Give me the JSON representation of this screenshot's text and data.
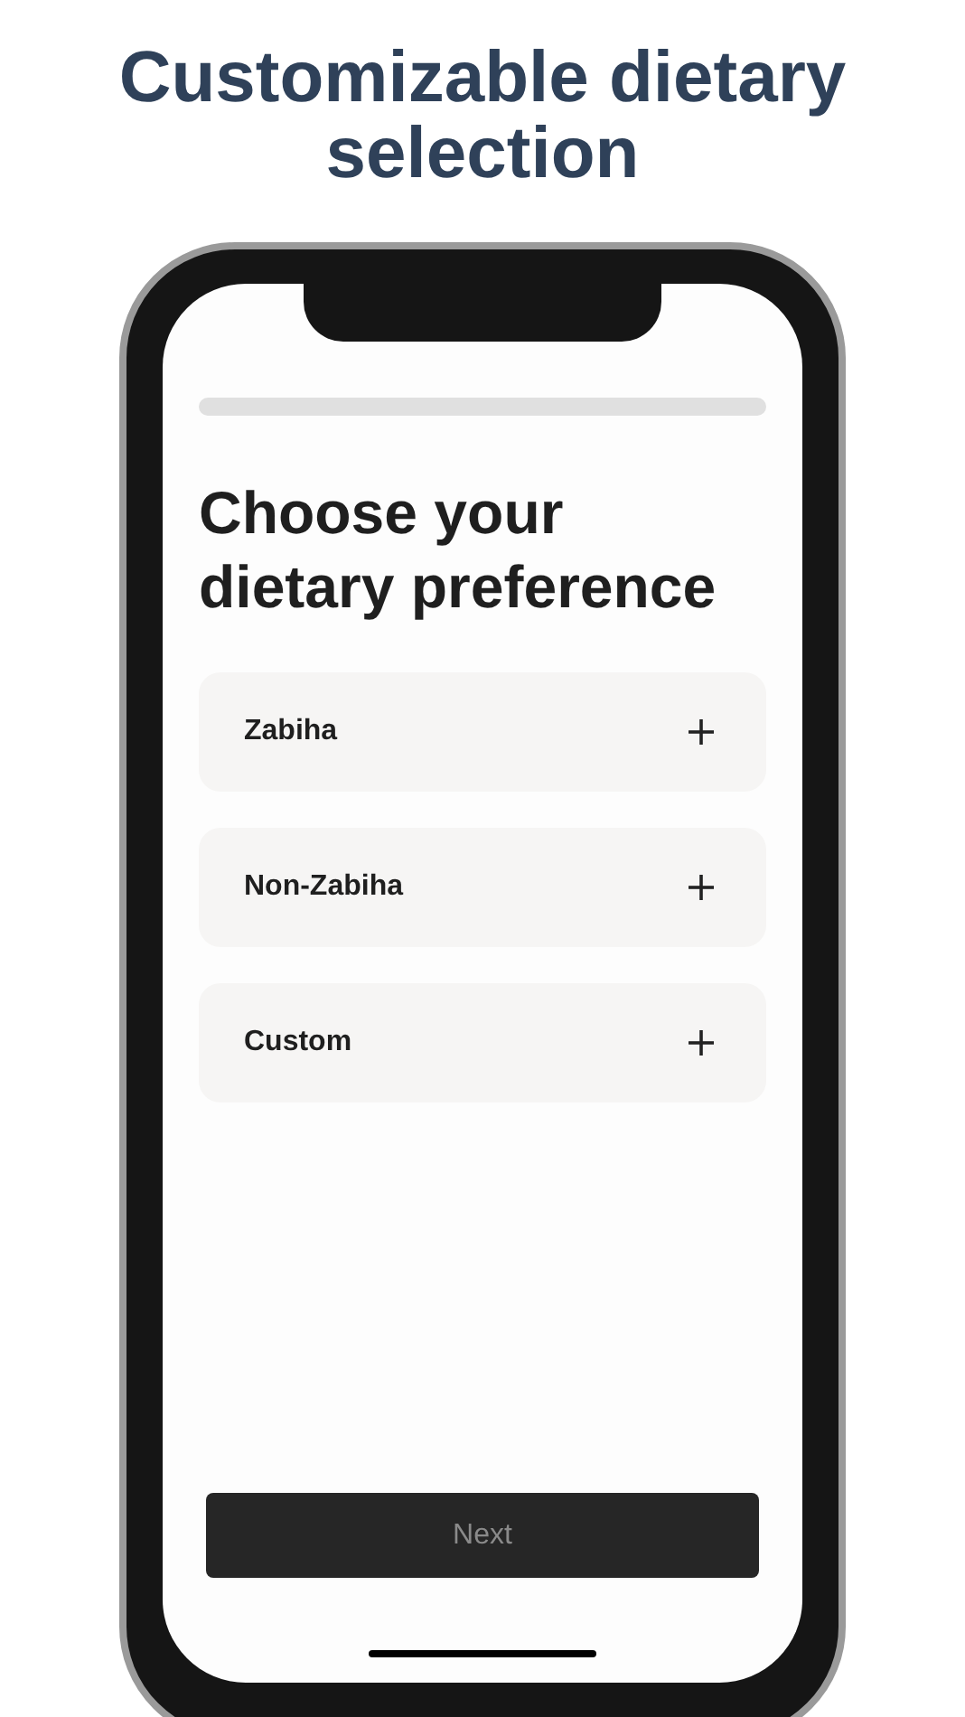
{
  "headline": "Customizable dietary selection",
  "progress": {
    "level": 0
  },
  "title": "Choose your dietary preference",
  "options": [
    {
      "label": "Zabiha",
      "expanded": false
    },
    {
      "label": "Non-Zabiha",
      "expanded": false
    },
    {
      "label": "Custom",
      "expanded": false
    }
  ],
  "next_button": {
    "label": "Next",
    "disabled": true
  }
}
